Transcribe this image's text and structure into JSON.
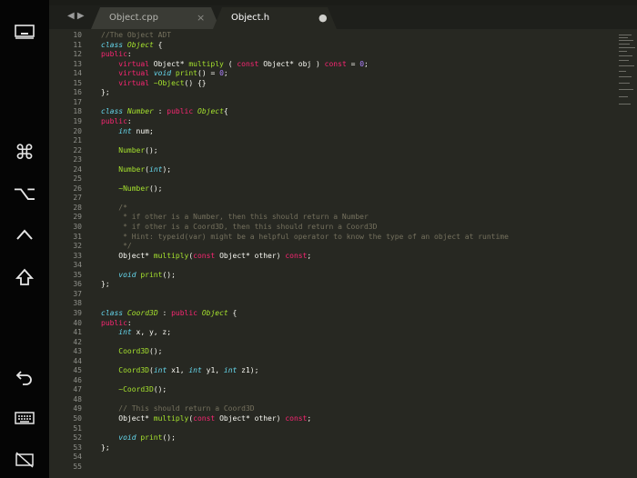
{
  "tabs": [
    {
      "label": "Object.cpp",
      "active": false,
      "close_glyph": "×"
    },
    {
      "label": "Object.h",
      "active": true,
      "modified_glyph": "●"
    }
  ],
  "nav_arrows": "◀ ▶",
  "sidebar_icons": [
    "screen-icon",
    "command-icon",
    "option-icon",
    "control-icon",
    "shift-icon",
    "undo-icon",
    "keyboard-icon",
    "disconnect-icon"
  ],
  "sidebar_glyphs": {
    "command": "⌘",
    "option": "⌥"
  },
  "colors": {
    "bg": "#272822",
    "keyword": "#f92672",
    "type": "#66d9ef",
    "comment": "#75715e",
    "number": "#ae81ff",
    "function": "#a6e22e",
    "text": "#f8f8f2"
  },
  "lines": [
    {
      "n": "10",
      "t": [
        {
          "c": "cm",
          "v": "//The Object ADT"
        }
      ]
    },
    {
      "n": "11",
      "t": [
        {
          "c": "ty",
          "v": "class"
        },
        {
          "c": "tx",
          "v": " "
        },
        {
          "c": "fn it",
          "v": "Object"
        },
        {
          "c": "tx",
          "v": " {"
        }
      ]
    },
    {
      "n": "12",
      "t": [
        {
          "c": "kw",
          "v": "public"
        },
        {
          "c": "tx",
          "v": ":"
        }
      ]
    },
    {
      "n": "13",
      "t": [
        {
          "c": "tx",
          "v": "    "
        },
        {
          "c": "kw",
          "v": "virtual"
        },
        {
          "c": "tx",
          "v": " Object* "
        },
        {
          "c": "fn",
          "v": "multiply"
        },
        {
          "c": "tx",
          "v": " ( "
        },
        {
          "c": "kw",
          "v": "const"
        },
        {
          "c": "tx",
          "v": " Object* obj ) "
        },
        {
          "c": "kw",
          "v": "const"
        },
        {
          "c": "tx",
          "v": " = "
        },
        {
          "c": "nm",
          "v": "0"
        },
        {
          "c": "tx",
          "v": ";"
        }
      ]
    },
    {
      "n": "14",
      "t": [
        {
          "c": "tx",
          "v": "    "
        },
        {
          "c": "kw",
          "v": "virtual"
        },
        {
          "c": "tx",
          "v": " "
        },
        {
          "c": "ty",
          "v": "void"
        },
        {
          "c": "tx",
          "v": " "
        },
        {
          "c": "fn",
          "v": "print"
        },
        {
          "c": "tx",
          "v": "() = "
        },
        {
          "c": "nm",
          "v": "0"
        },
        {
          "c": "tx",
          "v": ";"
        }
      ]
    },
    {
      "n": "15",
      "t": [
        {
          "c": "tx",
          "v": "    "
        },
        {
          "c": "kw",
          "v": "virtual"
        },
        {
          "c": "tx",
          "v": " "
        },
        {
          "c": "fn",
          "v": "~Object"
        },
        {
          "c": "tx",
          "v": "() {}"
        }
      ]
    },
    {
      "n": "16",
      "t": [
        {
          "c": "tx",
          "v": "};"
        }
      ]
    },
    {
      "n": "17",
      "t": []
    },
    {
      "n": "18",
      "t": [
        {
          "c": "ty",
          "v": "class"
        },
        {
          "c": "tx",
          "v": " "
        },
        {
          "c": "fn it",
          "v": "Number"
        },
        {
          "c": "tx",
          "v": " : "
        },
        {
          "c": "kw",
          "v": "public"
        },
        {
          "c": "tx",
          "v": " "
        },
        {
          "c": "fn it",
          "v": "Object"
        },
        {
          "c": "tx",
          "v": "{"
        }
      ]
    },
    {
      "n": "19",
      "t": [
        {
          "c": "kw",
          "v": "public"
        },
        {
          "c": "tx",
          "v": ":"
        }
      ]
    },
    {
      "n": "20",
      "t": [
        {
          "c": "tx",
          "v": "    "
        },
        {
          "c": "ty",
          "v": "int"
        },
        {
          "c": "tx",
          "v": " num;"
        }
      ]
    },
    {
      "n": "21",
      "t": []
    },
    {
      "n": "22",
      "t": [
        {
          "c": "tx",
          "v": "    "
        },
        {
          "c": "fn",
          "v": "Number"
        },
        {
          "c": "tx",
          "v": "();"
        }
      ]
    },
    {
      "n": "23",
      "t": []
    },
    {
      "n": "24",
      "t": [
        {
          "c": "tx",
          "v": "    "
        },
        {
          "c": "fn",
          "v": "Number"
        },
        {
          "c": "tx",
          "v": "("
        },
        {
          "c": "ty",
          "v": "int"
        },
        {
          "c": "tx",
          "v": ");"
        }
      ]
    },
    {
      "n": "25",
      "t": []
    },
    {
      "n": "26",
      "t": [
        {
          "c": "tx",
          "v": "    "
        },
        {
          "c": "fn",
          "v": "~Number"
        },
        {
          "c": "tx",
          "v": "();"
        }
      ]
    },
    {
      "n": "27",
      "t": []
    },
    {
      "n": "28",
      "t": [
        {
          "c": "tx",
          "v": "    "
        },
        {
          "c": "cm",
          "v": "/*"
        }
      ]
    },
    {
      "n": "29",
      "t": [
        {
          "c": "tx",
          "v": "    "
        },
        {
          "c": "cm",
          "v": " * if other is a Number, then this should return a Number"
        }
      ]
    },
    {
      "n": "30",
      "t": [
        {
          "c": "tx",
          "v": "    "
        },
        {
          "c": "cm",
          "v": " * if other is a Coord3D, then this should return a Coord3D"
        }
      ]
    },
    {
      "n": "31",
      "t": [
        {
          "c": "tx",
          "v": "    "
        },
        {
          "c": "cm",
          "v": " * Hint: typeid(var) might be a helpful operator to know the type of an object at runtime"
        }
      ]
    },
    {
      "n": "32",
      "t": [
        {
          "c": "tx",
          "v": "    "
        },
        {
          "c": "cm",
          "v": " */"
        }
      ]
    },
    {
      "n": "33",
      "t": [
        {
          "c": "tx",
          "v": "    Object* "
        },
        {
          "c": "fn",
          "v": "multiply"
        },
        {
          "c": "tx",
          "v": "("
        },
        {
          "c": "kw",
          "v": "const"
        },
        {
          "c": "tx",
          "v": " Object* other) "
        },
        {
          "c": "kw",
          "v": "const"
        },
        {
          "c": "tx",
          "v": ";"
        }
      ]
    },
    {
      "n": "34",
      "t": []
    },
    {
      "n": "35",
      "t": [
        {
          "c": "tx",
          "v": "    "
        },
        {
          "c": "ty",
          "v": "void"
        },
        {
          "c": "tx",
          "v": " "
        },
        {
          "c": "fn",
          "v": "print"
        },
        {
          "c": "tx",
          "v": "();"
        }
      ]
    },
    {
      "n": "36",
      "t": [
        {
          "c": "tx",
          "v": "};"
        }
      ]
    },
    {
      "n": "37",
      "t": []
    },
    {
      "n": "38",
      "t": []
    },
    {
      "n": "39",
      "t": [
        {
          "c": "ty",
          "v": "class"
        },
        {
          "c": "tx",
          "v": " "
        },
        {
          "c": "fn it",
          "v": "Coord3D"
        },
        {
          "c": "tx",
          "v": " : "
        },
        {
          "c": "kw",
          "v": "public"
        },
        {
          "c": "tx",
          "v": " "
        },
        {
          "c": "fn it",
          "v": "Object"
        },
        {
          "c": "tx",
          "v": " {"
        }
      ]
    },
    {
      "n": "40",
      "t": [
        {
          "c": "kw",
          "v": "public"
        },
        {
          "c": "tx",
          "v": ":"
        }
      ]
    },
    {
      "n": "41",
      "t": [
        {
          "c": "tx",
          "v": "    "
        },
        {
          "c": "ty",
          "v": "int"
        },
        {
          "c": "tx",
          "v": " x, y, z;"
        }
      ]
    },
    {
      "n": "42",
      "t": []
    },
    {
      "n": "43",
      "t": [
        {
          "c": "tx",
          "v": "    "
        },
        {
          "c": "fn",
          "v": "Coord3D"
        },
        {
          "c": "tx",
          "v": "();"
        }
      ]
    },
    {
      "n": "44",
      "t": []
    },
    {
      "n": "45",
      "t": [
        {
          "c": "tx",
          "v": "    "
        },
        {
          "c": "fn",
          "v": "Coord3D"
        },
        {
          "c": "tx",
          "v": "("
        },
        {
          "c": "ty",
          "v": "int"
        },
        {
          "c": "tx",
          "v": " x1, "
        },
        {
          "c": "ty",
          "v": "int"
        },
        {
          "c": "tx",
          "v": " y1, "
        },
        {
          "c": "ty",
          "v": "int"
        },
        {
          "c": "tx",
          "v": " z1);"
        }
      ]
    },
    {
      "n": "46",
      "t": []
    },
    {
      "n": "47",
      "t": [
        {
          "c": "tx",
          "v": "    "
        },
        {
          "c": "fn",
          "v": "~Coord3D"
        },
        {
          "c": "tx",
          "v": "();"
        }
      ]
    },
    {
      "n": "48",
      "t": []
    },
    {
      "n": "49",
      "t": [
        {
          "c": "tx",
          "v": "    "
        },
        {
          "c": "cm",
          "v": "// This should return a Coord3D"
        }
      ]
    },
    {
      "n": "50",
      "t": [
        {
          "c": "tx",
          "v": "    Object* "
        },
        {
          "c": "fn",
          "v": "multiply"
        },
        {
          "c": "tx",
          "v": "("
        },
        {
          "c": "kw",
          "v": "const"
        },
        {
          "c": "tx",
          "v": " Object* other) "
        },
        {
          "c": "kw",
          "v": "const"
        },
        {
          "c": "tx",
          "v": ";"
        }
      ]
    },
    {
      "n": "51",
      "t": []
    },
    {
      "n": "52",
      "t": [
        {
          "c": "tx",
          "v": "    "
        },
        {
          "c": "ty",
          "v": "void"
        },
        {
          "c": "tx",
          "v": " "
        },
        {
          "c": "fn",
          "v": "print"
        },
        {
          "c": "tx",
          "v": "();"
        }
      ]
    },
    {
      "n": "53",
      "t": [
        {
          "c": "tx",
          "v": "};"
        }
      ]
    },
    {
      "n": "54",
      "t": []
    },
    {
      "n": "55",
      "t": []
    }
  ]
}
